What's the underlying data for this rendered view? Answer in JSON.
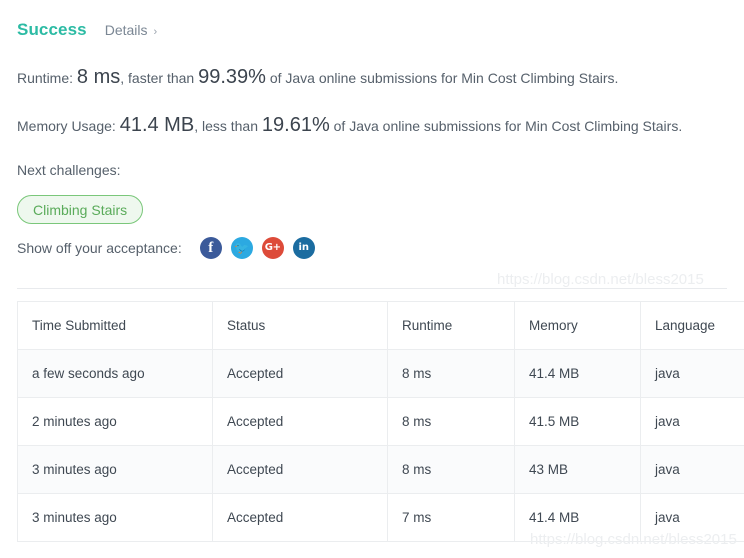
{
  "header": {
    "status_title": "Success",
    "details_label": "Details",
    "details_chevron": "›"
  },
  "stats": {
    "runtime": {
      "label_prefix": "Runtime:",
      "value": "8 ms",
      "mid_text": ", faster than",
      "percent": "99.39%",
      "suffix": "of Java online submissions for Min Cost Climbing Stairs."
    },
    "memory": {
      "label_prefix": "Memory Usage:",
      "value": "41.4 MB",
      "mid_text": ", less than",
      "percent": "19.61%",
      "suffix": "of Java online submissions for Min Cost Climbing Stairs."
    }
  },
  "next_challenges": {
    "label": "Next challenges:",
    "badges": [
      {
        "label": "Climbing Stairs"
      }
    ]
  },
  "share": {
    "label": "Show off your acceptance:",
    "icons": [
      {
        "name": "facebook-icon",
        "glyph": "f"
      },
      {
        "name": "twitter-icon",
        "glyph": "🐦"
      },
      {
        "name": "google-plus-icon",
        "glyph": "G+"
      },
      {
        "name": "linkedin-icon",
        "glyph": "in"
      }
    ]
  },
  "submissions_table": {
    "columns": [
      "Time Submitted",
      "Status",
      "Runtime",
      "Memory",
      "Language"
    ],
    "rows": [
      {
        "time": "a few seconds ago",
        "status": "Accepted",
        "runtime": "8 ms",
        "memory": "41.4 MB",
        "language": "java"
      },
      {
        "time": "2 minutes ago",
        "status": "Accepted",
        "runtime": "8 ms",
        "memory": "41.5 MB",
        "language": "java"
      },
      {
        "time": "3 minutes ago",
        "status": "Accepted",
        "runtime": "8 ms",
        "memory": "43 MB",
        "language": "java"
      },
      {
        "time": "3 minutes ago",
        "status": "Accepted",
        "runtime": "7 ms",
        "memory": "41.4 MB",
        "language": "java"
      }
    ]
  },
  "watermark": {
    "text": "https://blog.csdn.net/bless2015"
  },
  "colors": {
    "success_teal": "#2cbba4",
    "accepted_teal": "#2cbba4",
    "badge_green": "#5aab5a",
    "badge_bg": "#eef8ee",
    "text_primary": "#3f4852",
    "text_secondary": "#56606b",
    "facebook": "#3b5a9a",
    "twitter": "#2ca9e1",
    "google_plus": "#dd4b39",
    "linkedin": "#1b6ca0"
  }
}
